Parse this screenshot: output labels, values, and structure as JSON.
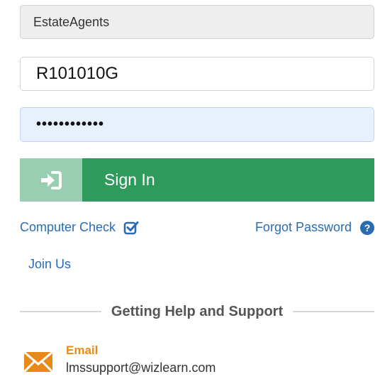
{
  "login": {
    "organization_value": "EstateAgents",
    "username_value": "R101010G",
    "password_value": "••••••••••••",
    "signin_label": "Sign In"
  },
  "links": {
    "computer_check": "Computer Check",
    "forgot_password": "Forgot Password",
    "join_us": "Join Us"
  },
  "help": {
    "title": "Getting Help and Support",
    "email_label": "Email",
    "email_address": "lmssupport@wizlearn.com"
  },
  "icons": {
    "signin": "sign-in-icon",
    "computer_check": "check-square-icon",
    "forgot_password": "question-circle-icon",
    "email": "envelope-icon"
  },
  "colors": {
    "signin_dark": "#2e9b5d",
    "signin_light": "#99ceb2",
    "link": "#2b6cb0",
    "email_accent": "#e88a1a",
    "password_bg": "#e8f0fe",
    "org_bg": "#eeeeee"
  }
}
